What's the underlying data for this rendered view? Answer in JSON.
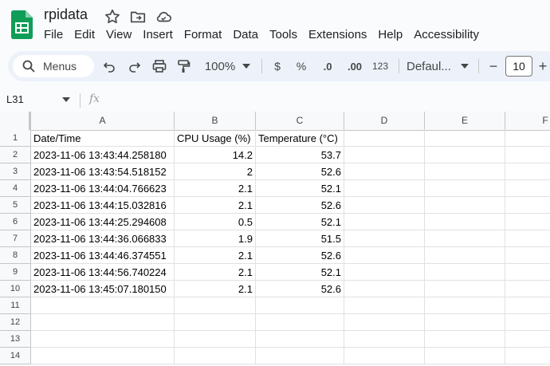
{
  "app": {
    "title": "rpidata"
  },
  "menu": [
    "File",
    "Edit",
    "View",
    "Insert",
    "Format",
    "Data",
    "Tools",
    "Extensions",
    "Help",
    "Accessibility"
  ],
  "toolbar": {
    "menus_label": "Menus",
    "zoom": "100%",
    "currency": "$",
    "percent": "%",
    "dec_decrease": ".0",
    "dec_increase": ".00",
    "number_format": "123",
    "font": "Defaul...",
    "font_size": "10",
    "minus": "−",
    "plus": "+"
  },
  "formula_bar": {
    "name_box": "L31",
    "fx": "fx",
    "formula": ""
  },
  "grid": {
    "columns": [
      "A",
      "B",
      "C",
      "D",
      "E",
      "F"
    ],
    "rows": [
      {
        "n": "1",
        "a": "Date/Time",
        "b": "CPU Usage (%)",
        "c": "Temperature (°C)"
      },
      {
        "n": "2",
        "a": "2023-11-06 13:43:44.258180",
        "b": "14.2",
        "c": "53.7"
      },
      {
        "n": "3",
        "a": "2023-11-06 13:43:54.518152",
        "b": "2",
        "c": "52.6"
      },
      {
        "n": "4",
        "a": "2023-11-06 13:44:04.766623",
        "b": "2.1",
        "c": "52.1"
      },
      {
        "n": "5",
        "a": "2023-11-06 13:44:15.032816",
        "b": "2.1",
        "c": "52.6"
      },
      {
        "n": "6",
        "a": "2023-11-06 13:44:25.294608",
        "b": "0.5",
        "c": "52.1"
      },
      {
        "n": "7",
        "a": "2023-11-06 13:44:36.066833",
        "b": "1.9",
        "c": "51.5"
      },
      {
        "n": "8",
        "a": "2023-11-06 13:44:46.374551",
        "b": "2.1",
        "c": "52.6"
      },
      {
        "n": "9",
        "a": "2023-11-06 13:44:56.740224",
        "b": "2.1",
        "c": "52.1"
      },
      {
        "n": "10",
        "a": "2023-11-06 13:45:07.180150",
        "b": "2.1",
        "c": "52.6"
      },
      {
        "n": "11",
        "a": "",
        "b": "",
        "c": ""
      },
      {
        "n": "12",
        "a": "",
        "b": "",
        "c": ""
      },
      {
        "n": "13",
        "a": "",
        "b": "",
        "c": ""
      },
      {
        "n": "14",
        "a": "",
        "b": "",
        "c": ""
      }
    ]
  },
  "colors": {
    "sheets_green": "#0f9d58",
    "toolbar_bg": "#edf2fa"
  }
}
